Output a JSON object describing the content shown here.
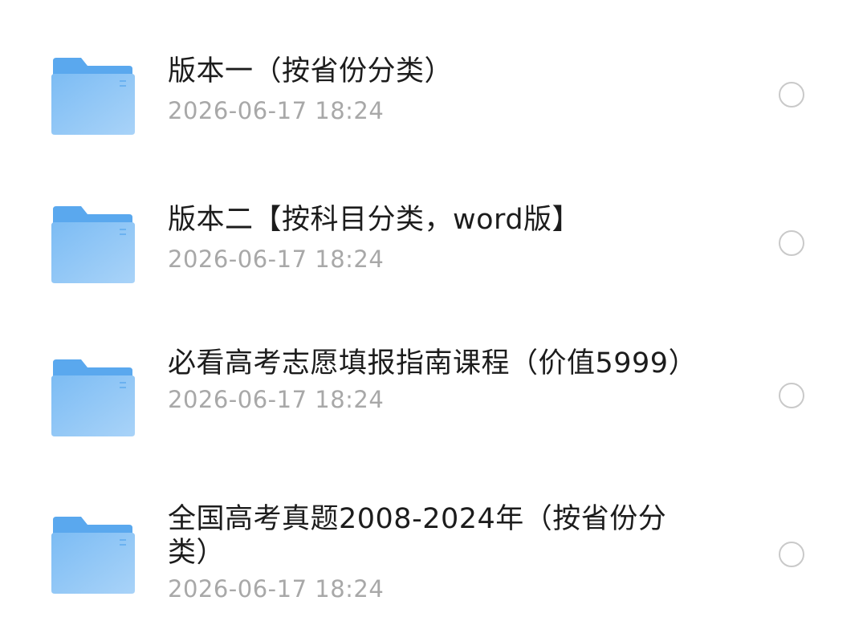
{
  "files": [
    {
      "name": "版本一（按省份分类）",
      "date": "2026-06-17 18:24",
      "icon": "folder-icon",
      "selected": false
    },
    {
      "name": "版本二【按科目分类，word版】",
      "date": "2026-06-17 18:24",
      "icon": "folder-icon",
      "selected": false
    },
    {
      "name": "必看高考志愿填报指南课程（价值5999）",
      "date": "2026-06-17 18:24",
      "icon": "folder-icon",
      "selected": false
    },
    {
      "name": "全国高考真题2008-2024年（按省份分类）",
      "date": "2026-06-17 18:24",
      "icon": "folder-icon",
      "selected": false
    }
  ],
  "colors": {
    "folder_back": "#5aa8ee",
    "folder_front": "#8ec5f6",
    "title_text": "#1c1c1c",
    "date_text": "#a8a8a8",
    "radio_border": "#c9c9c9"
  }
}
